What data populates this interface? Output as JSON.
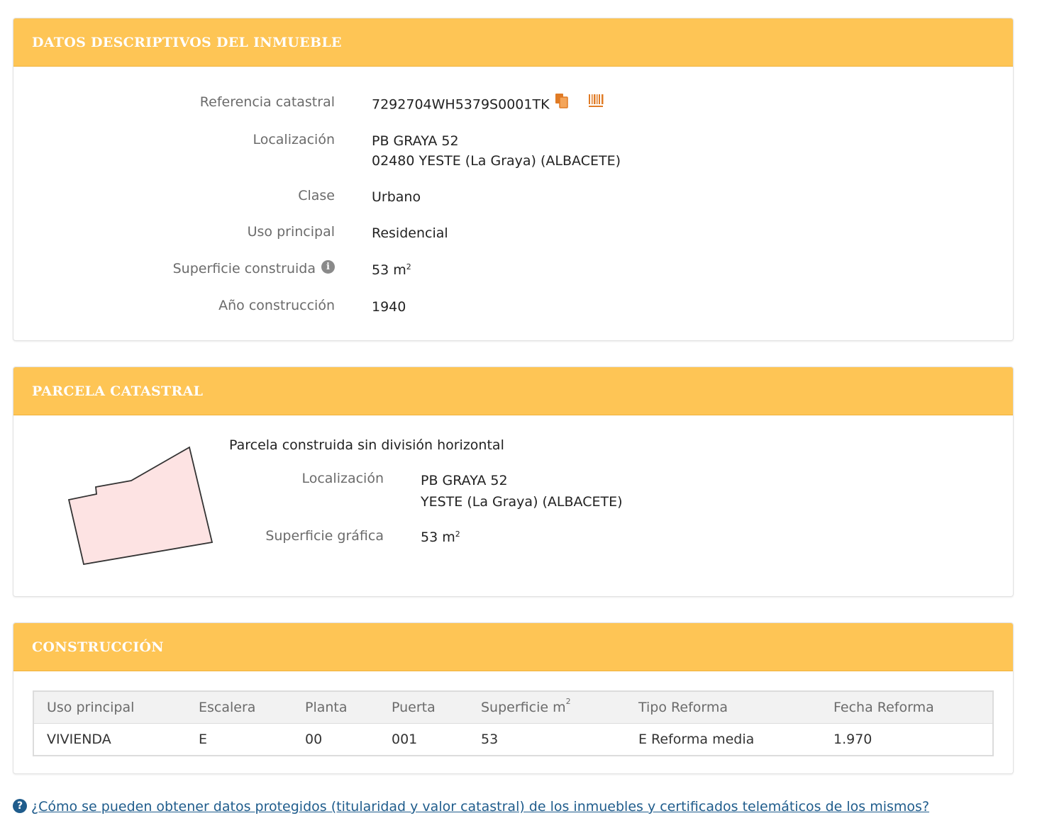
{
  "inmueble": {
    "title": "DATOS DESCRIPTIVOS DEL INMUEBLE",
    "referencia_label": "Referencia catastral",
    "referencia_value": "7292704WH5379S0001TK",
    "localizacion_label": "Localización",
    "localizacion_line1": "PB GRAYA 52",
    "localizacion_line2": "02480 YESTE (La Graya) (ALBACETE)",
    "clase_label": "Clase",
    "clase_value": "Urbano",
    "uso_label": "Uso principal",
    "uso_value": "Residencial",
    "superficie_label": "Superficie construida",
    "superficie_value": "53 m",
    "superficie_unit_sup": "2",
    "anio_label": "Año construcción",
    "anio_value": "1940",
    "icons": [
      "copy-icon",
      "barcode-icon",
      "info-icon"
    ],
    "copy_icon_color": "#e07b25",
    "barcode_icon_color": "#e07b25"
  },
  "parcela": {
    "title": "PARCELA CATASTRAL",
    "description": "Parcela construida sin división horizontal",
    "localizacion_label": "Localización",
    "localizacion_line1": "PB GRAYA 52",
    "localizacion_line2": "YESTE (La Graya) (ALBACETE)",
    "superficie_label": "Superficie gráfica",
    "superficie_value": "53 m",
    "superficie_unit_sup": "2",
    "shape_fill": "#fde3e3",
    "shape_stroke": "#333333"
  },
  "construccion": {
    "title": "CONSTRUCCIÓN",
    "headers": [
      "Uso principal",
      "Escalera",
      "Planta",
      "Puerta",
      "Superficie m",
      "Tipo Reforma",
      "Fecha Reforma"
    ],
    "superficie_header_sup": "2",
    "rows": [
      [
        "VIVIENDA",
        "E",
        "00",
        "001",
        "53",
        "E Reforma media",
        "1.970"
      ]
    ]
  },
  "help_link": "¿Cómo se pueden obtener datos protegidos (titularidad y valor catastral) de los inmuebles y certificados telemáticos de los mismos?",
  "colors": {
    "header_bg": "#fec555",
    "link": "#1f5c8c"
  }
}
